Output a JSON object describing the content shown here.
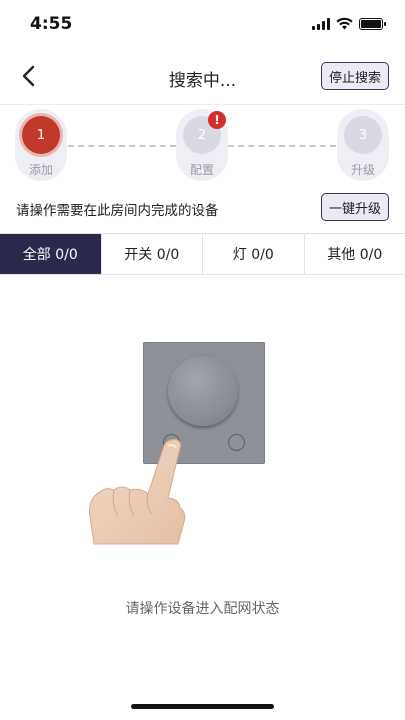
{
  "status_bar": {
    "time": "4:55"
  },
  "nav": {
    "title": "搜索中...",
    "stop_label": "停止搜索"
  },
  "steps": [
    {
      "number": "1",
      "label": "添加",
      "state": "active"
    },
    {
      "number": "2",
      "label": "配置",
      "state": "alert",
      "badge": "!"
    },
    {
      "number": "3",
      "label": "升级",
      "state": "idle"
    }
  ],
  "instruction": {
    "text": "请操作需要在此房间内完成的设备",
    "upgrade_label": "一键升级"
  },
  "tabs": [
    {
      "label": "全部 0/0",
      "active": true
    },
    {
      "label": "开关 0/0",
      "active": false
    },
    {
      "label": "灯 0/0",
      "active": false
    },
    {
      "label": "其他 0/0",
      "active": false
    }
  ],
  "prompt": "请操作设备进入配网状态",
  "colors": {
    "accent_red": "#c0392b",
    "tab_active": "#2b2a4c",
    "alert": "#d32f2f"
  }
}
